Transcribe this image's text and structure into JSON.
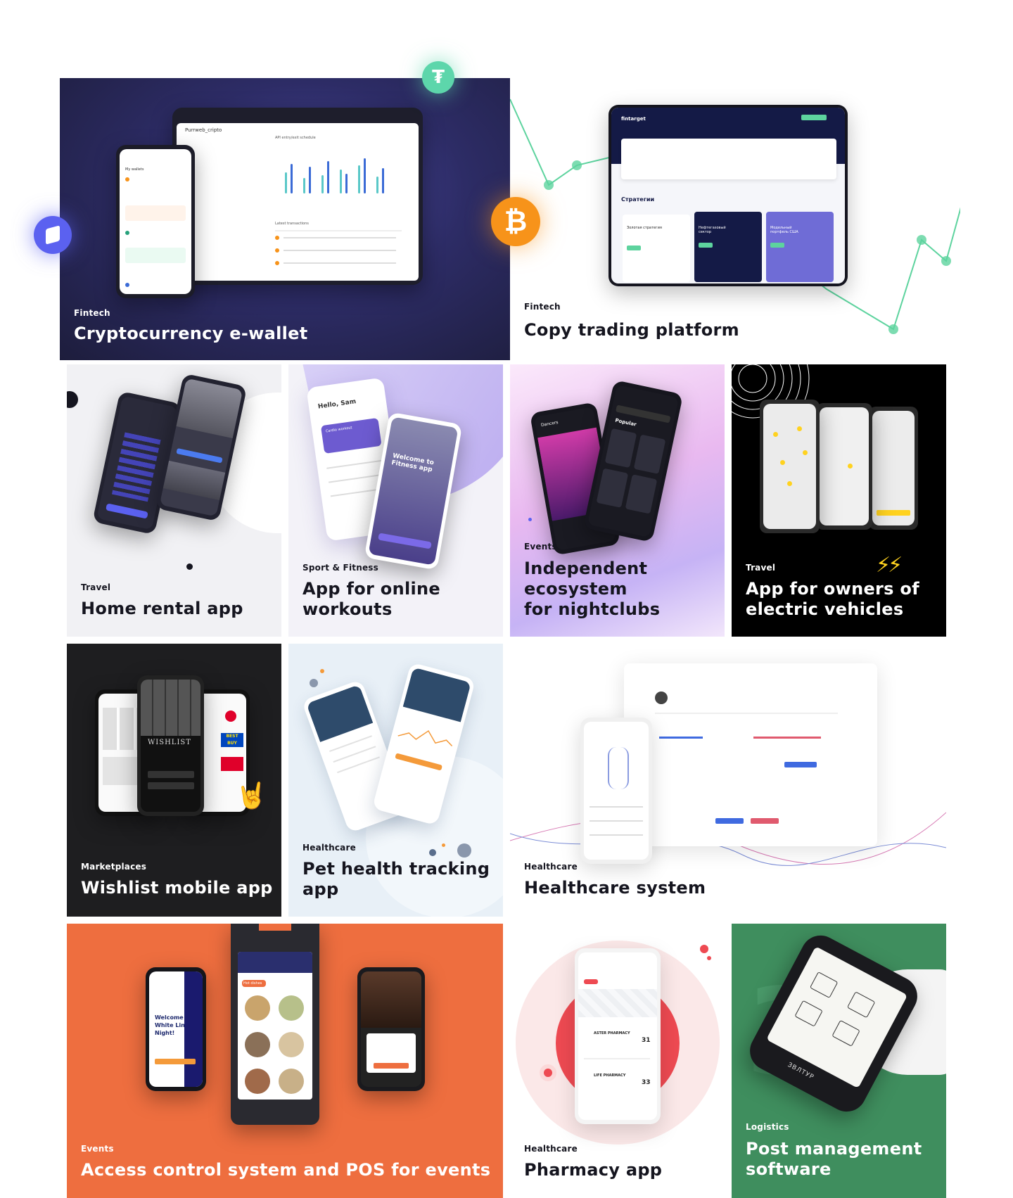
{
  "cards": [
    {
      "id": "crypto",
      "category": "Fintech",
      "title": "Cryptocurrency e-wallet"
    },
    {
      "id": "copy",
      "category": "Fintech",
      "title": "Copy trading platform"
    },
    {
      "id": "rental",
      "category": "Travel",
      "title": "Home rental app"
    },
    {
      "id": "workouts",
      "category": "Sport & Fitness",
      "title": "App for online\nworkouts"
    },
    {
      "id": "nightclubs",
      "category": "Events",
      "title": "Independent\necosystem\nfor nightclubs"
    },
    {
      "id": "ev",
      "category": "Travel",
      "title": "App for owners of\nelectric vehicles"
    },
    {
      "id": "wishlist",
      "category": "Marketplaces",
      "title": "Wishlist mobile app"
    },
    {
      "id": "pet",
      "category": "Healthcare",
      "title": "Pet health tracking\napp"
    },
    {
      "id": "health",
      "category": "Healthcare",
      "title": "Healthcare system"
    },
    {
      "id": "access",
      "category": "Events",
      "title": "Access control system and POS for events"
    },
    {
      "id": "pharmacy",
      "category": "Healthcare",
      "title": "Pharmacy app"
    },
    {
      "id": "post",
      "category": "Logistics",
      "title": "Post management\nsoftware"
    }
  ],
  "mock_text": {
    "crypto_screen_title": "Purrweb_cripto",
    "crypto_wallet_label": "My wallets",
    "crypto_chart_label": "API entry/exit schedule",
    "crypto_tx_label": "Latest transactions",
    "copy_brand": "fintarget",
    "copy_section": "Стратегии",
    "copy_strat1": "Золотая стратегия",
    "copy_strat2": "Нефтегазовый сектор",
    "copy_strat3": "Модельный портфель США",
    "workout_greeting": "Hello, Sam",
    "workout_card": "Cardio workout",
    "workout_welcome": "Welcome to Fitness app",
    "night_dancers": "Dancers",
    "night_popular": "Popular",
    "wishlist_word": "WISHLIST",
    "wishlist_bestbuy": "BEST BUY",
    "access_welcome": "Welcome to White Linen Night!",
    "access_food": "Hot dishes",
    "pharmacy_name1": "ASTER PHARMACY",
    "pharmacy_name2": "LIFE PHARMACY",
    "pharmacy_num1": "31",
    "pharmacy_num2": "33",
    "post_brand": "ЗВЛТУР"
  },
  "colors": {
    "crypto_bg": "#2b2a5e",
    "copy_line": "#5dd39e",
    "bitcoin": "#f7931a",
    "tether": "#26a17b",
    "ev_accent": "#ffd21f",
    "orange_card": "#ee6e3f",
    "green_card": "#3f8e5e",
    "workout_bg": "#f0eef8",
    "pet_bg": "#e8f0f7",
    "night_grad": "#e9b9f0"
  },
  "icons": [
    "bitcoin-icon",
    "tether-icon",
    "ethereum-icon",
    "lightning-icon",
    "hand-icon"
  ]
}
